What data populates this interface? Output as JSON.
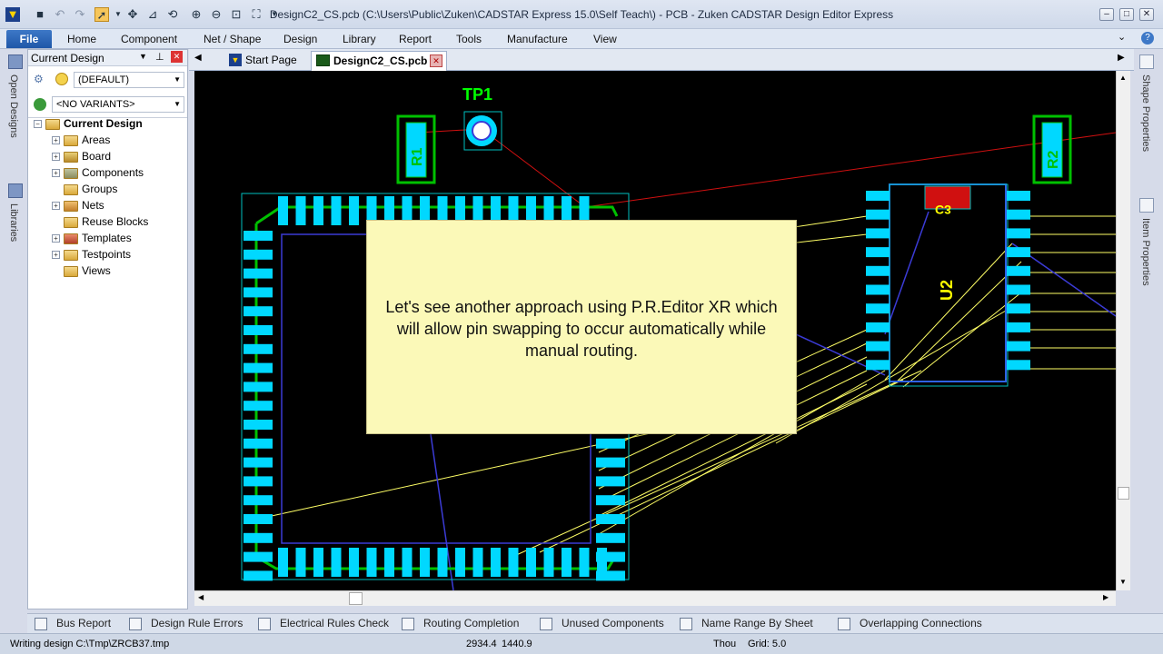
{
  "window": {
    "title": "DesignC2_CS.pcb (C:\\Users\\Public\\Zuken\\CADSTAR Express 15.0\\Self Teach\\) - PCB - Zuken CADSTAR Design Editor Express"
  },
  "ribbon": {
    "file": "File",
    "tabs": [
      "Home",
      "Component",
      "Net / Shape",
      "Design",
      "Library",
      "Report",
      "Tools",
      "Manufacture",
      "View"
    ]
  },
  "left_strip": {
    "open_designs": "Open Designs",
    "libraries": "Libraries"
  },
  "right_strip": {
    "shape_properties": "Shape Properties",
    "item_properties": "Item Properties"
  },
  "panel": {
    "title": "Current Design",
    "variant_default": "(DEFAULT)",
    "variants": "<NO VARIANTS>",
    "root": "Current Design",
    "items": [
      "Areas",
      "Board",
      "Components",
      "Groups",
      "Nets",
      "Reuse Blocks",
      "Templates",
      "Testpoints",
      "Views"
    ]
  },
  "doc_tabs": {
    "start": "Start Page",
    "active": "DesignC2_CS.pcb"
  },
  "canvas": {
    "labels": {
      "tp1": "TP1",
      "r1": "R1",
      "r2": "R2",
      "u2": "U2",
      "c3": "C3"
    }
  },
  "callout": {
    "text": "Let's see another approach using P.R.Editor XR which will allow pin swapping to occur automatically while manual routing."
  },
  "bottom_tabs": [
    "Bus Report",
    "Design Rule Errors",
    "Electrical Rules Check",
    "Routing Completion",
    "Unused Components",
    "Name Range By Sheet",
    "Overlapping Connections"
  ],
  "status": {
    "message": "Writing design C:\\Tmp\\ZRCB37.tmp",
    "x": "2934.4",
    "y": "1440.9",
    "units": "Thou",
    "grid": "Grid: 5.0"
  },
  "colors": {
    "pad": "#00d8ff",
    "outline": "#00c000",
    "ratsnest": "#ffff66",
    "track": "#3b3bd6",
    "selected": "#d01010"
  }
}
